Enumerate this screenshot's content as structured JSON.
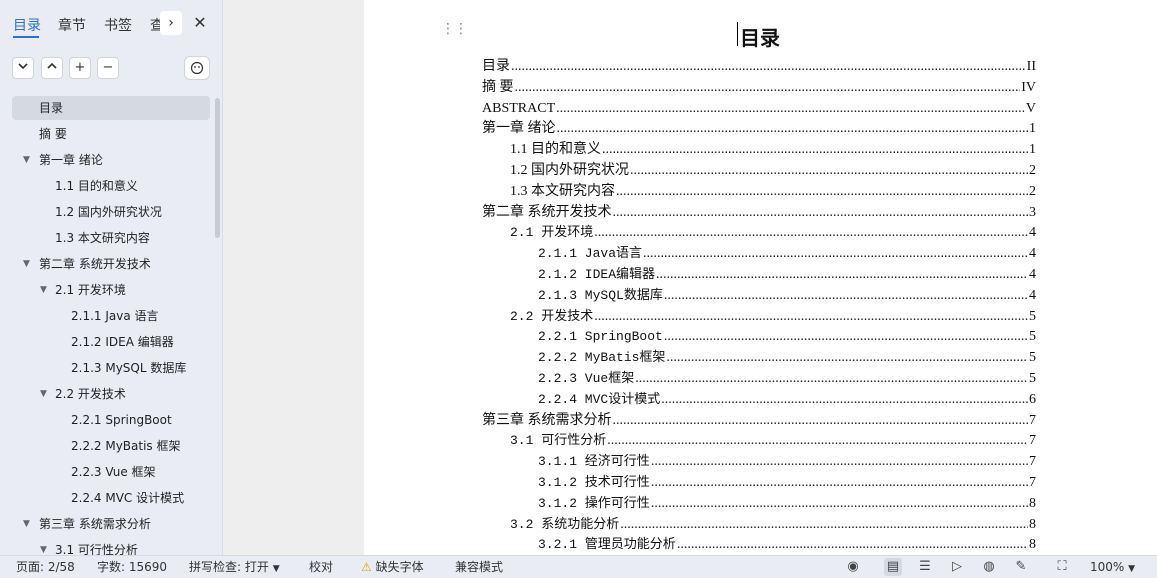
{
  "sidebar": {
    "tabs": [
      {
        "label": "目录",
        "active": true
      },
      {
        "label": "章节"
      },
      {
        "label": "书签"
      },
      {
        "label": "查"
      }
    ],
    "next_icon": "›",
    "close_icon": "✕",
    "toolbar": {
      "collapse": "⌄",
      "expand": "⌃",
      "add": "+",
      "remove": "−",
      "ai": "◔"
    },
    "items": [
      {
        "label": "目录",
        "level": 0,
        "caret": false,
        "selected": true
      },
      {
        "label": "摘  要",
        "level": 0,
        "caret": false
      },
      {
        "label": "第一章  绪论",
        "level": 0,
        "caret": true
      },
      {
        "label": "1.1  目的和意义",
        "level": 1,
        "caret": false
      },
      {
        "label": "1.2  国内外研究状况",
        "level": 1,
        "caret": false
      },
      {
        "label": "1.3  本文研究内容",
        "level": 1,
        "caret": false
      },
      {
        "label": "第二章  系统开发技术",
        "level": 0,
        "caret": true
      },
      {
        "label": "2.1  开发环境",
        "level": 1,
        "caret": true
      },
      {
        "label": "2.1.1 Java 语言",
        "level": 2,
        "caret": false
      },
      {
        "label": "2.1.2 IDEA 编辑器",
        "level": 2,
        "caret": false
      },
      {
        "label": "2.1.3 MySQL 数据库",
        "level": 2,
        "caret": false
      },
      {
        "label": "2.2  开发技术",
        "level": 1,
        "caret": true
      },
      {
        "label": "2.2.1 SpringBoot",
        "level": 2,
        "caret": false
      },
      {
        "label": "2.2.2 MyBatis 框架",
        "level": 2,
        "caret": false
      },
      {
        "label": "2.2.3 Vue 框架",
        "level": 2,
        "caret": false
      },
      {
        "label": "2.2.4 MVC 设计模式",
        "level": 2,
        "caret": false
      },
      {
        "label": "第三章  系统需求分析",
        "level": 0,
        "caret": true
      },
      {
        "label": "3.1  可行性分析",
        "level": 1,
        "caret": true
      }
    ]
  },
  "document": {
    "title": "目录",
    "toc": [
      {
        "text": "目录",
        "page": "II",
        "level": 0
      },
      {
        "text": "摘  要",
        "page": "IV",
        "level": 0
      },
      {
        "text": "ABSTRACT",
        "page": "V",
        "level": 0
      },
      {
        "text": "第一章  绪论",
        "page": "1",
        "level": 0
      },
      {
        "text": "1.1 目的和意义",
        "page": "1",
        "level": 1
      },
      {
        "text": "1.2 国内外研究状况",
        "page": "2",
        "level": 1
      },
      {
        "text": "1.3 本文研究内容",
        "page": "2",
        "level": 1
      },
      {
        "text": "第二章  系统开发技术",
        "page": "3",
        "level": 0
      },
      {
        "text": "2.1 开发环境",
        "page": "4",
        "level": 1,
        "mono": true
      },
      {
        "text": "2.1.1 Java语言",
        "page": "4",
        "level": 2,
        "mono": true
      },
      {
        "text": "2.1.2 IDEA编辑器",
        "page": "4",
        "level": 2,
        "mono": true
      },
      {
        "text": "2.1.3 MySQL数据库",
        "page": "4",
        "level": 2,
        "mono": true
      },
      {
        "text": "2.2 开发技术",
        "page": "5",
        "level": 1,
        "mono": true
      },
      {
        "text": "2.2.1 SpringBoot",
        "page": "5",
        "level": 2,
        "mono": true
      },
      {
        "text": "2.2.2 MyBatis框架",
        "page": "5",
        "level": 2,
        "mono": true
      },
      {
        "text": "2.2.3 Vue框架",
        "page": "5",
        "level": 2,
        "mono": true
      },
      {
        "text": "2.2.4 MVC设计模式",
        "page": "6",
        "level": 2,
        "mono": true
      },
      {
        "text": "第三章  系统需求分析",
        "page": "7",
        "level": 0
      },
      {
        "text": "3.1 可行性分析",
        "page": "7",
        "level": 1,
        "mono": true
      },
      {
        "text": "3.1.1 经济可行性",
        "page": "7",
        "level": 2,
        "mono": true
      },
      {
        "text": "3.1.2 技术可行性",
        "page": "7",
        "level": 2,
        "mono": true
      },
      {
        "text": "3.1.2 操作可行性",
        "page": "8",
        "level": 2,
        "mono": true
      },
      {
        "text": "3.2 系统功能分析",
        "page": "8",
        "level": 1,
        "mono": true
      },
      {
        "text": "3.2.1 管理员功能分析",
        "page": "8",
        "level": 2,
        "mono": true
      }
    ]
  },
  "status": {
    "page": "页面: 2/58",
    "words": "字数: 15690",
    "spellcheck": "拼写检查: 打开",
    "proofread": "校对",
    "missing_font": "缺失字体",
    "compat_mode": "兼容模式",
    "zoom": "100%"
  }
}
